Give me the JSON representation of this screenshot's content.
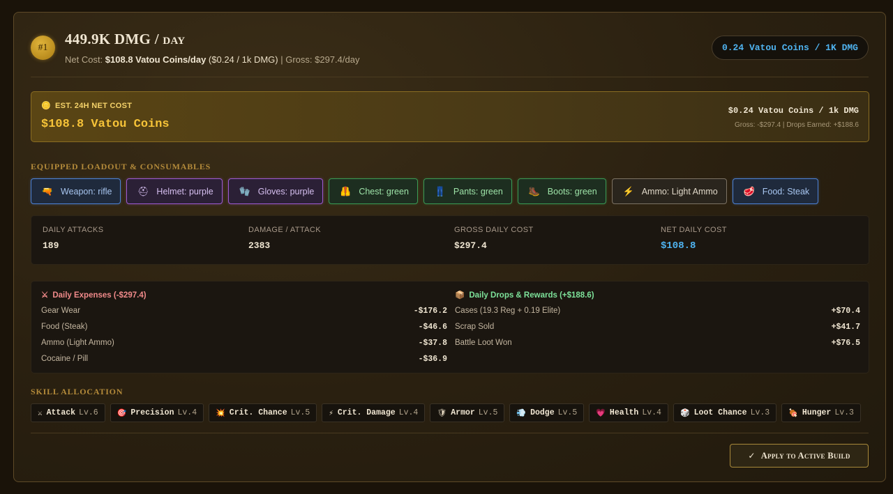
{
  "header": {
    "rank": "#1",
    "dmg_value": "449.9K DMG / ",
    "dmg_period": "day",
    "net_cost_label": "Net Cost: ",
    "net_cost_value": "$108.8 Vatou Coins/day",
    "rate_paren": " ($0.24 / 1k DMG)",
    "gross": " | Gross: $297.4/day",
    "pill": "0.24 Vatou Coins / 1K DMG"
  },
  "estimate": {
    "label": "EST. 24H NET COST",
    "value": "$108.8 Vatou Coins",
    "rate": "$0.24 Vatou Coins / 1k DMG",
    "note": "Gross: -$297.4 | Drops Earned: +$188.6",
    "icon": "coins-icon"
  },
  "loadout": {
    "title": "EQUIPPED LOADOUT & CONSUMABLES",
    "items": [
      {
        "label": "Weapon: rifle",
        "icon": "rifle-icon",
        "tier": "blue"
      },
      {
        "label": "Helmet: purple",
        "icon": "helmet-icon",
        "tier": "purple"
      },
      {
        "label": "Gloves: purple",
        "icon": "gloves-icon",
        "tier": "purple"
      },
      {
        "label": "Chest: green",
        "icon": "chest-armor-icon",
        "tier": "green"
      },
      {
        "label": "Pants: green",
        "icon": "pants-icon",
        "tier": "green"
      },
      {
        "label": "Boots: green",
        "icon": "boots-icon",
        "tier": "green"
      },
      {
        "label": "Ammo: Light Ammo",
        "icon": "ammo-icon",
        "tier": "gray"
      },
      {
        "label": "Food: Steak",
        "icon": "steak-icon",
        "tier": "blue"
      }
    ]
  },
  "stats": {
    "daily_attacks": {
      "label": "DAILY ATTACKS",
      "value": "189"
    },
    "damage_attack": {
      "label": "DAMAGE / ATTACK",
      "value": "2383"
    },
    "gross_daily": {
      "label": "GROSS DAILY COST",
      "value": "$297.4"
    },
    "net_daily": {
      "label": "NET DAILY COST",
      "value": "$108.8"
    }
  },
  "expenses": {
    "title": "Daily Expenses (-$297.4)",
    "icon": "crossed-swords-icon",
    "rows": [
      {
        "label": "Gear Wear",
        "amount": "-$176.2"
      },
      {
        "label": "Food (Steak)",
        "amount": "-$46.6"
      },
      {
        "label": "Ammo (Light Ammo)",
        "amount": "-$37.8"
      },
      {
        "label": "Cocaine / Pill",
        "amount": "-$36.9"
      }
    ]
  },
  "drops": {
    "title": "Daily Drops & Rewards (+$188.6)",
    "icon": "package-icon",
    "rows": [
      {
        "label": "Cases (19.3 Reg + 0.19 Elite)",
        "amount": "+$70.4"
      },
      {
        "label": "Scrap Sold",
        "amount": "+$41.7"
      },
      {
        "label": "Battle Loot Won",
        "amount": "+$76.5"
      }
    ]
  },
  "skills": {
    "title": "SKILL ALLOCATION",
    "items": [
      {
        "name": "Attack",
        "level": "Lv.6",
        "icon": "crossed-swords-icon"
      },
      {
        "name": "Precision",
        "level": "Lv.4",
        "icon": "target-icon"
      },
      {
        "name": "Crit. Chance",
        "level": "Lv.5",
        "icon": "burst-icon"
      },
      {
        "name": "Crit. Damage",
        "level": "Lv.4",
        "icon": "lightning-icon"
      },
      {
        "name": "Armor",
        "level": "Lv.5",
        "icon": "shield-icon"
      },
      {
        "name": "Dodge",
        "level": "Lv.5",
        "icon": "wind-icon"
      },
      {
        "name": "Health",
        "level": "Lv.4",
        "icon": "heart-icon"
      },
      {
        "name": "Loot Chance",
        "level": "Lv.3",
        "icon": "dice-icon"
      },
      {
        "name": "Hunger",
        "level": "Lv.3",
        "icon": "meat-icon"
      }
    ]
  },
  "apply_button": {
    "label": "Apply to Active Build",
    "icon": "checkmark-icon"
  }
}
